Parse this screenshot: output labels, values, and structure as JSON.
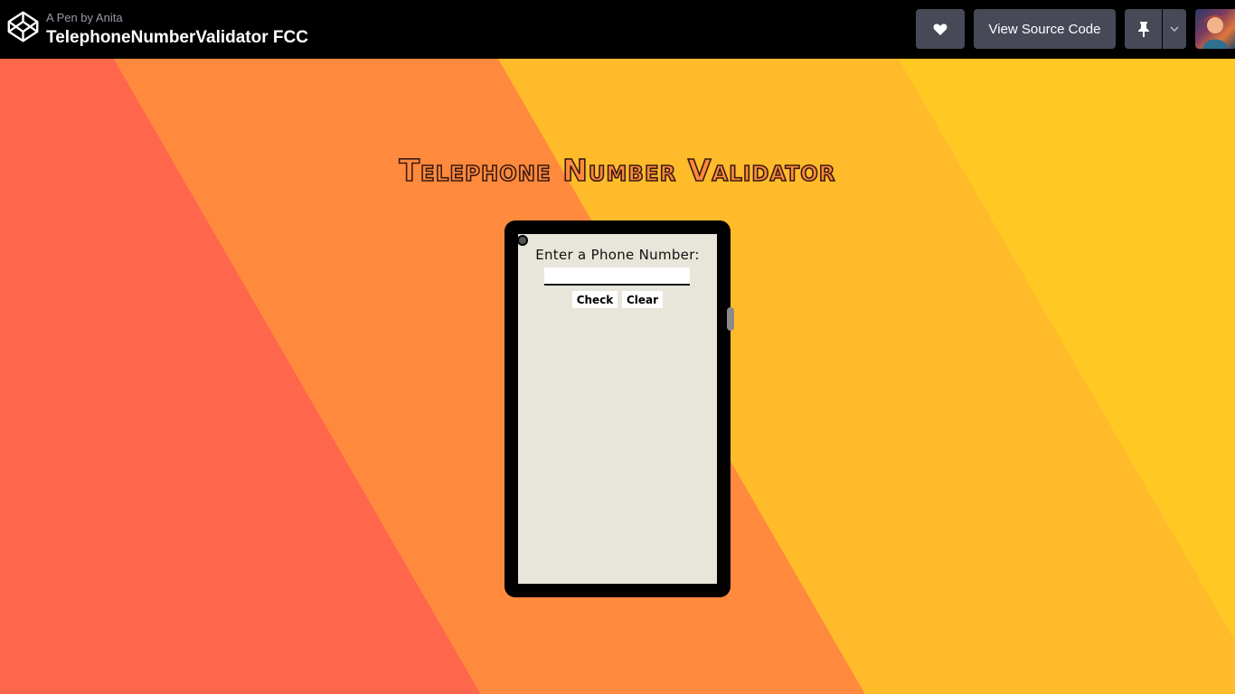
{
  "header": {
    "byline": "A Pen by Anita",
    "title": "TelephoneNumberValidator FCC",
    "view_source_label": "View Source Code",
    "icons": [
      "codepen-logo-icon",
      "heart-icon",
      "pin-icon",
      "chevron-down-icon"
    ],
    "background_color": "#000000",
    "button_color": "#474a56"
  },
  "app": {
    "title": "Telephone Number Validator",
    "prompt_label": "Enter a Phone Number:",
    "input_value": "",
    "check_label": "Check",
    "clear_label": "Clear",
    "background_colors": [
      "#ff674d",
      "#ff8a3d",
      "#ffbb2a",
      "#ffc823"
    ],
    "screen_color": "#e8e5da"
  }
}
